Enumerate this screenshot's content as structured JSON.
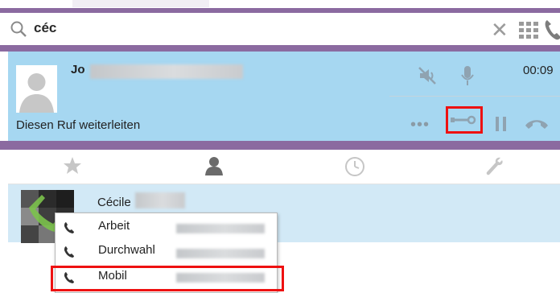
{
  "search": {
    "value": "céc"
  },
  "call": {
    "caller_name_prefix": "Jo",
    "timer": "00:09",
    "forward_label": "Diesen Ruf weiterleiten"
  },
  "contact": {
    "name_prefix": "Cécile"
  },
  "popup": {
    "items": [
      {
        "label": "Arbeit"
      },
      {
        "label": "Durchwahl"
      },
      {
        "label": "Mobil"
      }
    ]
  },
  "colors": {
    "accent_purple": "#8b6aa0",
    "call_panel": "#a6d7f1",
    "contact_row": "#d2e9f6",
    "highlight_red": "#e11111"
  }
}
